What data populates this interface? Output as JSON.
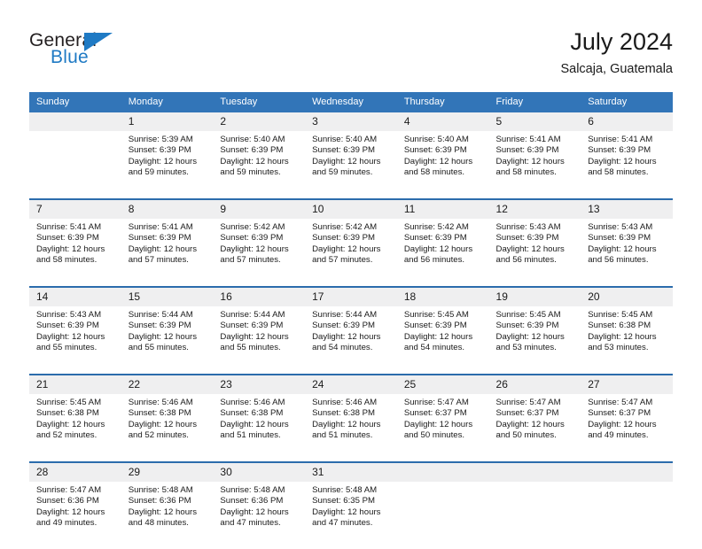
{
  "brand": {
    "name_primary": "General",
    "name_secondary": "Blue",
    "accent_color": "#1f7ac4"
  },
  "header": {
    "title": "July 2024",
    "subtitle": "Salcaja, Guatemala"
  },
  "calendar": {
    "header_bg": "#3275b8",
    "daynum_bg": "#efeff0",
    "separator_color": "#2b6cac",
    "weekdays": [
      "Sunday",
      "Monday",
      "Tuesday",
      "Wednesday",
      "Thursday",
      "Friday",
      "Saturday"
    ],
    "weeks": [
      [
        {
          "day": "",
          "lines": []
        },
        {
          "day": "1",
          "lines": [
            "Sunrise: 5:39 AM",
            "Sunset: 6:39 PM",
            "Daylight: 12 hours",
            "and 59 minutes."
          ]
        },
        {
          "day": "2",
          "lines": [
            "Sunrise: 5:40 AM",
            "Sunset: 6:39 PM",
            "Daylight: 12 hours",
            "and 59 minutes."
          ]
        },
        {
          "day": "3",
          "lines": [
            "Sunrise: 5:40 AM",
            "Sunset: 6:39 PM",
            "Daylight: 12 hours",
            "and 59 minutes."
          ]
        },
        {
          "day": "4",
          "lines": [
            "Sunrise: 5:40 AM",
            "Sunset: 6:39 PM",
            "Daylight: 12 hours",
            "and 58 minutes."
          ]
        },
        {
          "day": "5",
          "lines": [
            "Sunrise: 5:41 AM",
            "Sunset: 6:39 PM",
            "Daylight: 12 hours",
            "and 58 minutes."
          ]
        },
        {
          "day": "6",
          "lines": [
            "Sunrise: 5:41 AM",
            "Sunset: 6:39 PM",
            "Daylight: 12 hours",
            "and 58 minutes."
          ]
        }
      ],
      [
        {
          "day": "7",
          "lines": [
            "Sunrise: 5:41 AM",
            "Sunset: 6:39 PM",
            "Daylight: 12 hours",
            "and 58 minutes."
          ]
        },
        {
          "day": "8",
          "lines": [
            "Sunrise: 5:41 AM",
            "Sunset: 6:39 PM",
            "Daylight: 12 hours",
            "and 57 minutes."
          ]
        },
        {
          "day": "9",
          "lines": [
            "Sunrise: 5:42 AM",
            "Sunset: 6:39 PM",
            "Daylight: 12 hours",
            "and 57 minutes."
          ]
        },
        {
          "day": "10",
          "lines": [
            "Sunrise: 5:42 AM",
            "Sunset: 6:39 PM",
            "Daylight: 12 hours",
            "and 57 minutes."
          ]
        },
        {
          "day": "11",
          "lines": [
            "Sunrise: 5:42 AM",
            "Sunset: 6:39 PM",
            "Daylight: 12 hours",
            "and 56 minutes."
          ]
        },
        {
          "day": "12",
          "lines": [
            "Sunrise: 5:43 AM",
            "Sunset: 6:39 PM",
            "Daylight: 12 hours",
            "and 56 minutes."
          ]
        },
        {
          "day": "13",
          "lines": [
            "Sunrise: 5:43 AM",
            "Sunset: 6:39 PM",
            "Daylight: 12 hours",
            "and 56 minutes."
          ]
        }
      ],
      [
        {
          "day": "14",
          "lines": [
            "Sunrise: 5:43 AM",
            "Sunset: 6:39 PM",
            "Daylight: 12 hours",
            "and 55 minutes."
          ]
        },
        {
          "day": "15",
          "lines": [
            "Sunrise: 5:44 AM",
            "Sunset: 6:39 PM",
            "Daylight: 12 hours",
            "and 55 minutes."
          ]
        },
        {
          "day": "16",
          "lines": [
            "Sunrise: 5:44 AM",
            "Sunset: 6:39 PM",
            "Daylight: 12 hours",
            "and 55 minutes."
          ]
        },
        {
          "day": "17",
          "lines": [
            "Sunrise: 5:44 AM",
            "Sunset: 6:39 PM",
            "Daylight: 12 hours",
            "and 54 minutes."
          ]
        },
        {
          "day": "18",
          "lines": [
            "Sunrise: 5:45 AM",
            "Sunset: 6:39 PM",
            "Daylight: 12 hours",
            "and 54 minutes."
          ]
        },
        {
          "day": "19",
          "lines": [
            "Sunrise: 5:45 AM",
            "Sunset: 6:39 PM",
            "Daylight: 12 hours",
            "and 53 minutes."
          ]
        },
        {
          "day": "20",
          "lines": [
            "Sunrise: 5:45 AM",
            "Sunset: 6:38 PM",
            "Daylight: 12 hours",
            "and 53 minutes."
          ]
        }
      ],
      [
        {
          "day": "21",
          "lines": [
            "Sunrise: 5:45 AM",
            "Sunset: 6:38 PM",
            "Daylight: 12 hours",
            "and 52 minutes."
          ]
        },
        {
          "day": "22",
          "lines": [
            "Sunrise: 5:46 AM",
            "Sunset: 6:38 PM",
            "Daylight: 12 hours",
            "and 52 minutes."
          ]
        },
        {
          "day": "23",
          "lines": [
            "Sunrise: 5:46 AM",
            "Sunset: 6:38 PM",
            "Daylight: 12 hours",
            "and 51 minutes."
          ]
        },
        {
          "day": "24",
          "lines": [
            "Sunrise: 5:46 AM",
            "Sunset: 6:38 PM",
            "Daylight: 12 hours",
            "and 51 minutes."
          ]
        },
        {
          "day": "25",
          "lines": [
            "Sunrise: 5:47 AM",
            "Sunset: 6:37 PM",
            "Daylight: 12 hours",
            "and 50 minutes."
          ]
        },
        {
          "day": "26",
          "lines": [
            "Sunrise: 5:47 AM",
            "Sunset: 6:37 PM",
            "Daylight: 12 hours",
            "and 50 minutes."
          ]
        },
        {
          "day": "27",
          "lines": [
            "Sunrise: 5:47 AM",
            "Sunset: 6:37 PM",
            "Daylight: 12 hours",
            "and 49 minutes."
          ]
        }
      ],
      [
        {
          "day": "28",
          "lines": [
            "Sunrise: 5:47 AM",
            "Sunset: 6:36 PM",
            "Daylight: 12 hours",
            "and 49 minutes."
          ]
        },
        {
          "day": "29",
          "lines": [
            "Sunrise: 5:48 AM",
            "Sunset: 6:36 PM",
            "Daylight: 12 hours",
            "and 48 minutes."
          ]
        },
        {
          "day": "30",
          "lines": [
            "Sunrise: 5:48 AM",
            "Sunset: 6:36 PM",
            "Daylight: 12 hours",
            "and 47 minutes."
          ]
        },
        {
          "day": "31",
          "lines": [
            "Sunrise: 5:48 AM",
            "Sunset: 6:35 PM",
            "Daylight: 12 hours",
            "and 47 minutes."
          ]
        },
        {
          "day": "",
          "lines": []
        },
        {
          "day": "",
          "lines": []
        },
        {
          "day": "",
          "lines": []
        }
      ]
    ]
  }
}
